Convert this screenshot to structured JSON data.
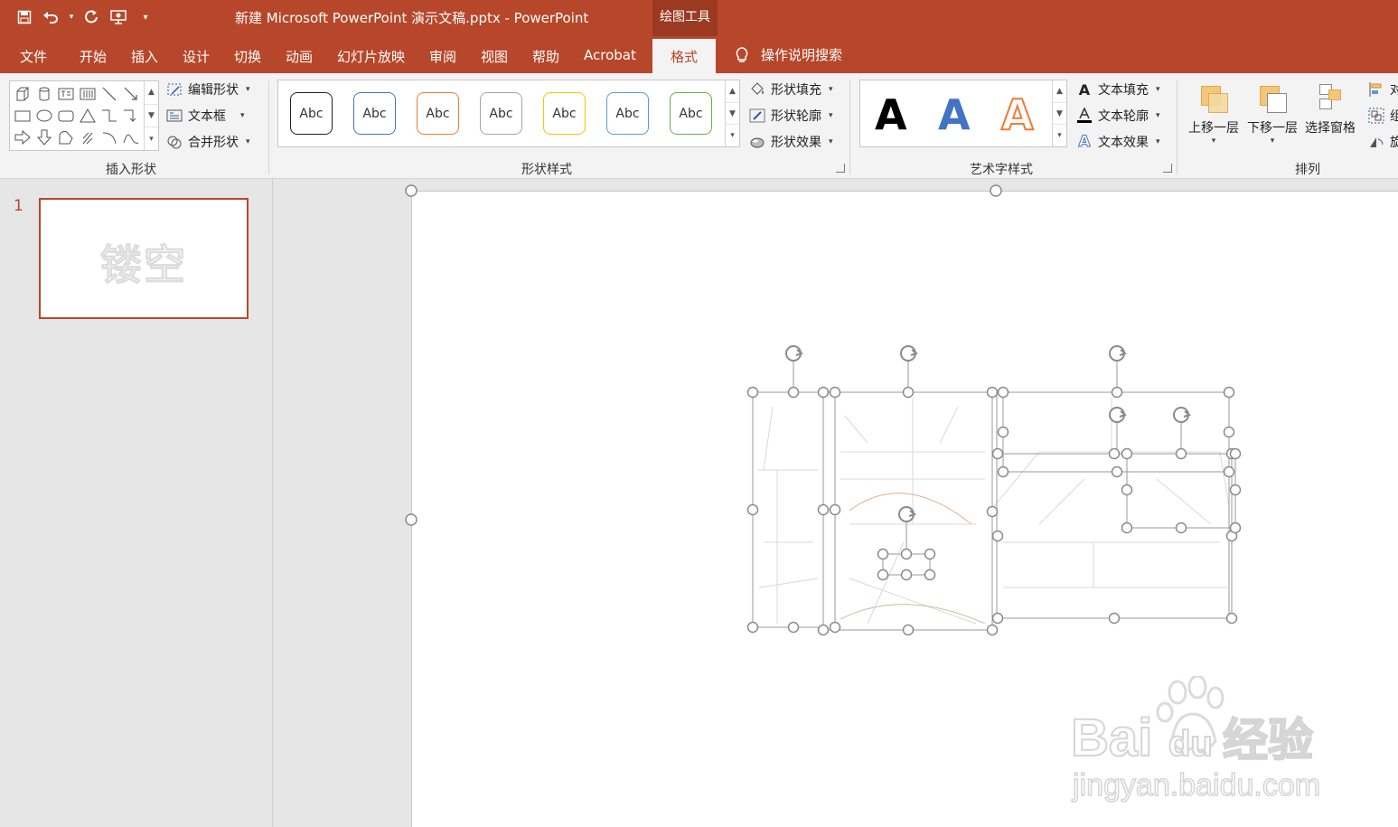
{
  "window": {
    "title": "新建 Microsoft PowerPoint 演示文稿.pptx  -  PowerPoint",
    "contextual_tab_group": "绘图工具"
  },
  "tabs": {
    "file": "文件",
    "home": "开始",
    "insert": "插入",
    "design": "设计",
    "transitions": "切换",
    "animations": "动画",
    "slideshow": "幻灯片放映",
    "review": "审阅",
    "view": "视图",
    "help": "帮助",
    "acrobat": "Acrobat",
    "format": "格式",
    "tell_me": "操作说明搜索"
  },
  "ribbon": {
    "insert_shapes": {
      "label": "插入形状",
      "edit_shape": "编辑形状",
      "text_box": "文本框",
      "merge_shapes": "合并形状"
    },
    "shape_styles": {
      "label": "形状样式",
      "preset_text": "Abc",
      "presets": [
        {
          "border": "#222222"
        },
        {
          "border": "#4472c4"
        },
        {
          "border": "#ed7d31"
        },
        {
          "border": "#a5a5a5"
        },
        {
          "border": "#ffc000"
        },
        {
          "border": "#5b9bd5"
        },
        {
          "border": "#70ad47"
        }
      ],
      "shape_fill": "形状填充",
      "shape_outline": "形状轮廓",
      "shape_effects": "形状效果"
    },
    "wordart_styles": {
      "label": "艺术字样式",
      "sample_letter": "A",
      "text_fill": "文本填充",
      "text_outline": "文本轮廓",
      "text_effects": "文本效果"
    },
    "arrange": {
      "label": "排列",
      "bring_forward": "上移一层",
      "send_backward": "下移一层",
      "selection_pane": "选择窗格",
      "align": "对",
      "group": "组",
      "rotate": "旋"
    }
  },
  "slides_pane": {
    "slide_number": "1",
    "thumbnail_text": "镂空"
  },
  "colors": {
    "accent": "#b7472a",
    "ribbon_bg": "#f3f3f3",
    "canvas_bg": "#e6e6e6"
  }
}
